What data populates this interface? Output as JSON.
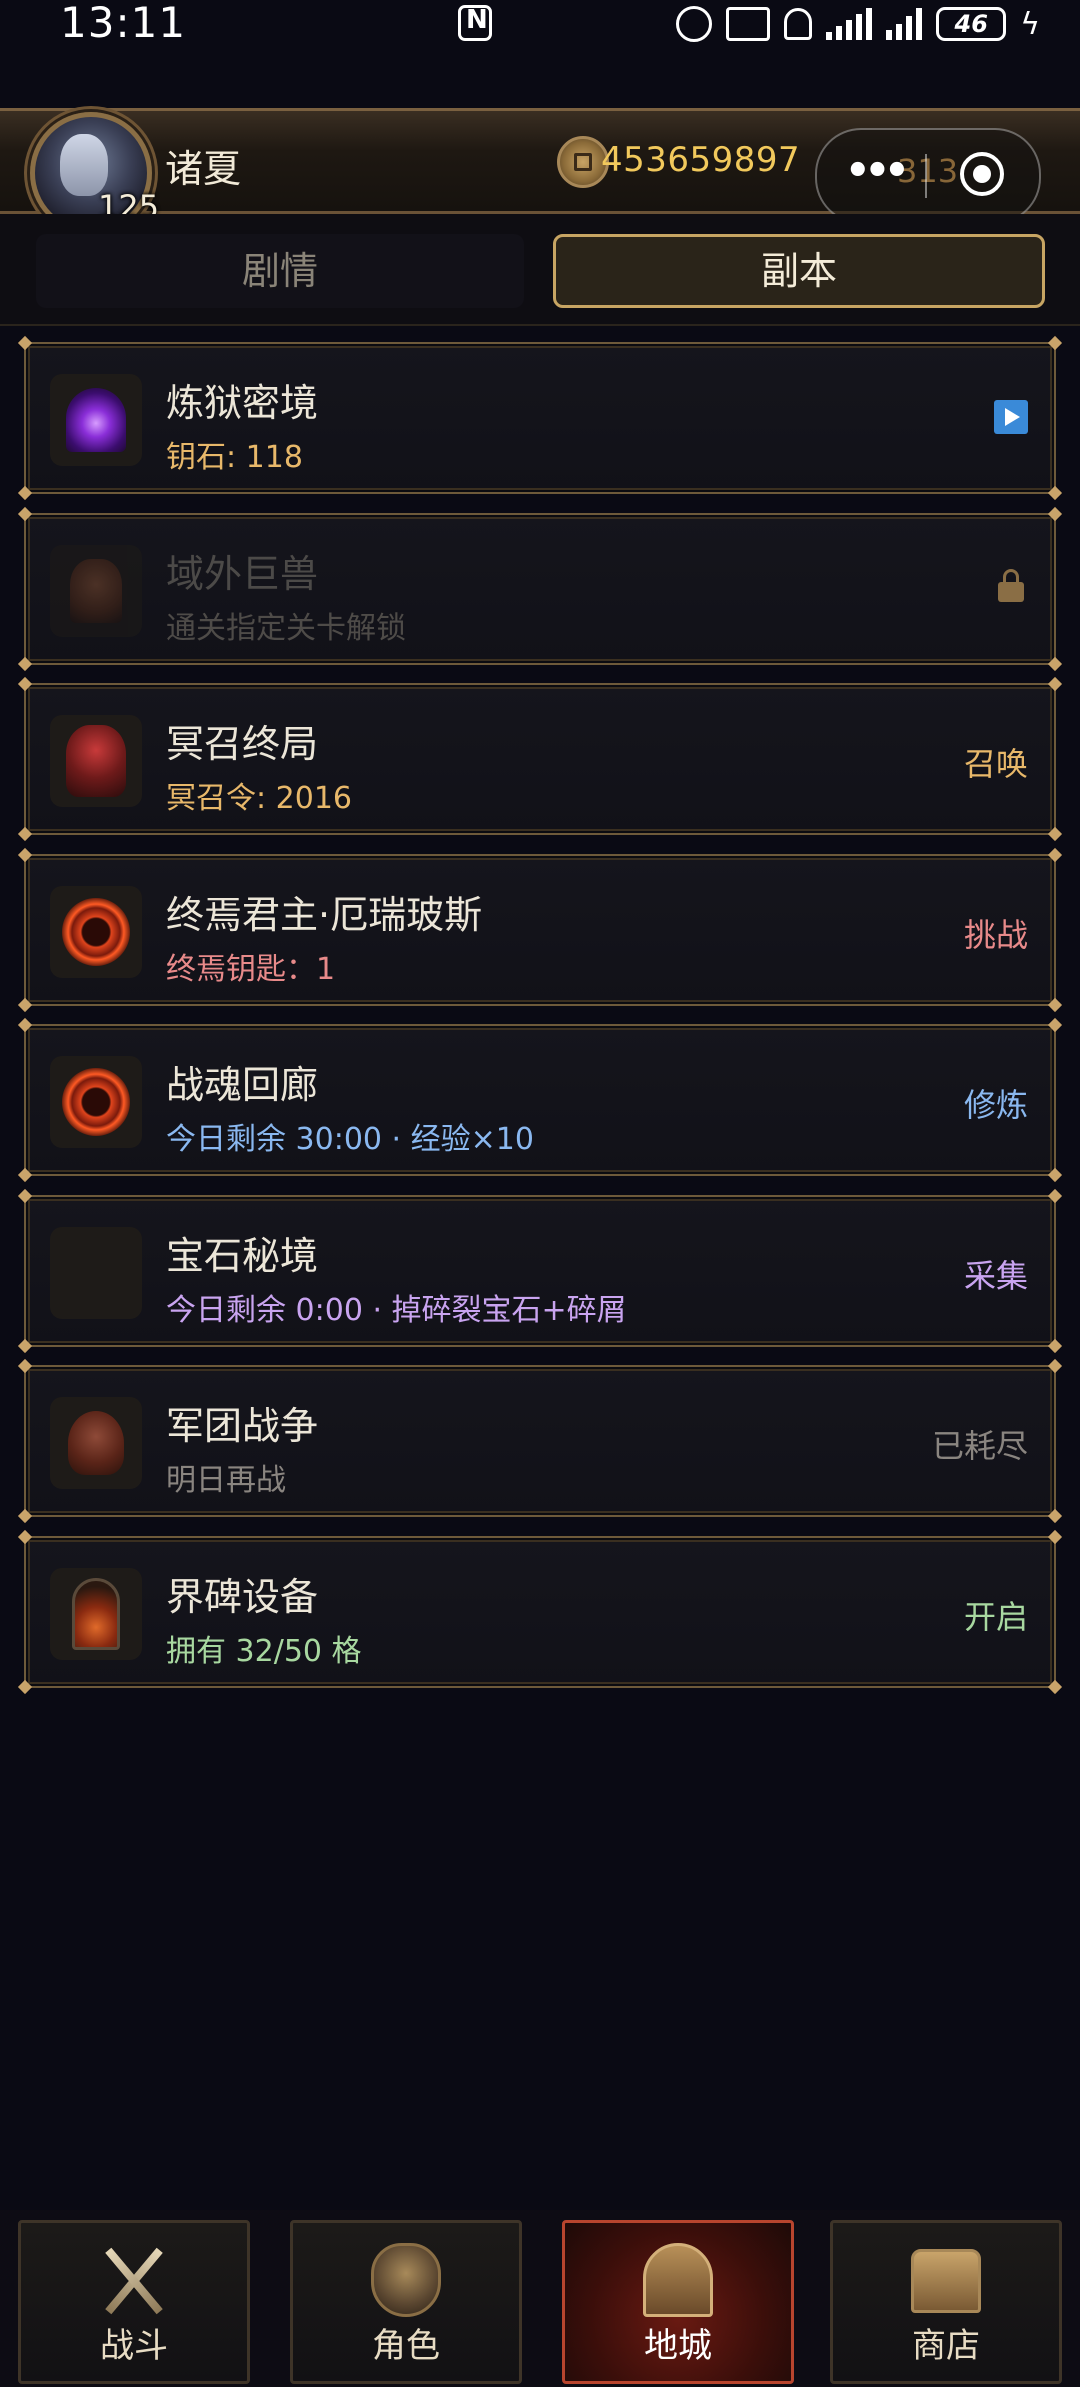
{
  "status_bar": {
    "time": "13:11",
    "battery": "46"
  },
  "header": {
    "player_name": "诸夏",
    "level": "125",
    "gold": "453659897",
    "energy": "313"
  },
  "tabs": [
    {
      "label": "剧情",
      "active": false
    },
    {
      "label": "副本",
      "active": true
    }
  ],
  "dungeons": [
    {
      "title": "炼狱密境",
      "subtitle": "钥石: 118",
      "action": "",
      "action_icon": "play-icon",
      "sub_color": "#e8b86a",
      "action_color": "#3a8ad8",
      "icon": "purple-portal-icon",
      "locked": false
    },
    {
      "title": "域外巨兽",
      "subtitle": "通关指定关卡解锁",
      "action": "",
      "action_icon": "lock-icon",
      "sub_color": "#4e4b48",
      "action_color": "#8a6e45",
      "icon": "beast-icon",
      "locked": true
    },
    {
      "title": "冥召终局",
      "subtitle": "冥召令: 2016",
      "action": "召唤",
      "sub_color": "#e8b86a",
      "action_color": "#e8b86a",
      "icon": "demon-icon",
      "locked": false
    },
    {
      "title": "终焉君主·厄瑞玻斯",
      "subtitle": "终焉钥匙：1",
      "action": "挑战",
      "sub_color": "#e88a8a",
      "action_color": "#e88a8a",
      "icon": "fire-ring-icon",
      "locked": false
    },
    {
      "title": "战魂回廊",
      "subtitle": "今日剩余 30:00 · 经验×10",
      "action": "修炼",
      "sub_color": "#8ab8f0",
      "action_color": "#8ab8f0",
      "icon": "fire-ring-icon",
      "locked": false
    },
    {
      "title": "宝石秘境",
      "subtitle": "今日剩余 0:00 · 掉碎裂宝石+碎屑",
      "action": "采集",
      "sub_color": "#c9a4f0",
      "action_color": "#c9a4f0",
      "icon": "empty-icon",
      "locked": false
    },
    {
      "title": "军团战争",
      "subtitle": "明日再战",
      "action": "已耗尽",
      "sub_color": "#8a8580",
      "action_color": "#8a8580",
      "icon": "skull-icon",
      "locked": false
    },
    {
      "title": "界碑设备",
      "subtitle": "拥有 32/50 格",
      "action": "开启",
      "sub_color": "#a8d8a0",
      "action_color": "#a8d8a0",
      "icon": "gate-icon",
      "locked": false
    }
  ],
  "bottom_nav": [
    {
      "label": "战斗",
      "icon": "crossed-swords-icon",
      "active": false
    },
    {
      "label": "角色",
      "icon": "helmet-icon",
      "active": false
    },
    {
      "label": "地城",
      "icon": "dungeon-gate-icon",
      "active": true
    },
    {
      "label": "商店",
      "icon": "treasure-chest-icon",
      "active": false
    }
  ]
}
